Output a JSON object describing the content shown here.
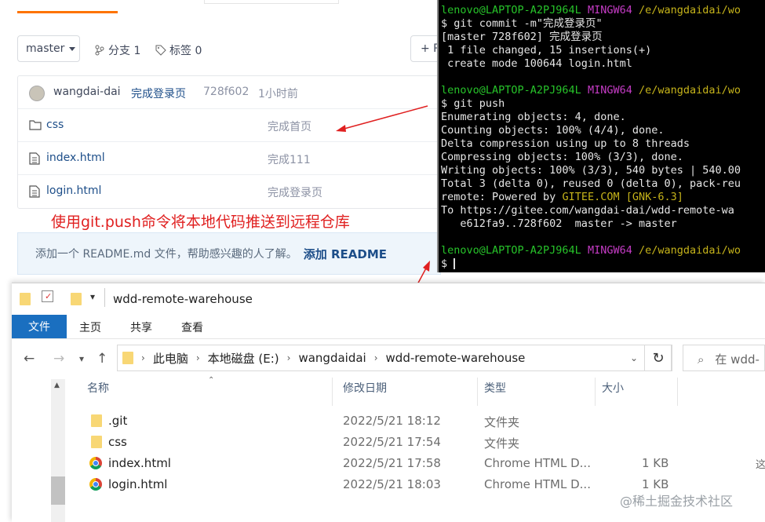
{
  "gitee": {
    "branch": "master",
    "branch_count_label": "分支 1",
    "tag_count_label": "标签 0",
    "plus_label": "+ P",
    "commit": {
      "author": "wangdai-dai",
      "message": "完成登录页",
      "hash": "728f602",
      "time": "1小时前"
    },
    "files": [
      {
        "name": "css",
        "message": "完成首页",
        "icon": "folder-icon"
      },
      {
        "name": "index.html",
        "message": "完成111",
        "icon": "file-icon"
      },
      {
        "name": "login.html",
        "message": "完成登录页",
        "icon": "file-icon"
      }
    ],
    "annotation": "使用git.push命令将本地代码推送到远程仓库",
    "readme_prompt": "添加一个 README.md 文件，帮助感兴趣的人了解。",
    "readme_link": "添加 README",
    "accent_color": "#fe7300"
  },
  "terminal": {
    "prompt_user": "lenovo@LAPTOP-A2PJ964L",
    "prompt_shell": "MINGW64",
    "prompt_path": "/e/wangdaidai/wo",
    "cmd_commit": "$ git commit -m\"完成登录页\"",
    "commit_out": [
      "[master 728f602] 完成登录页",
      " 1 file changed, 15 insertions(+)",
      " create mode 100644 login.html"
    ],
    "prompt2_path": "/e/wangdaidai/wo",
    "cmd_push": "$ git push",
    "push_out": [
      "Enumerating objects: 4, done.",
      "Counting objects: 100% (4/4), done.",
      "Delta compression using up to 8 threads",
      "Compressing objects: 100% (3/3), done.",
      "Writing objects: 100% (3/3), 540 bytes | 540.00",
      "Total 3 (delta 0), reused 0 (delta 0), pack-reu"
    ],
    "remote_prefix": "remote: Powered by ",
    "remote_site": "GITEE.COM",
    "remote_tag": "[GNK-6.3]",
    "push_to": "To https://gitee.com/wangdai-dai/wdd-remote-wa",
    "push_ref": "   e612fa9..728f602  master -> master",
    "prompt3_path": "/e/wangdaidai/wo",
    "last_prompt": "$"
  },
  "explorer": {
    "title": "wdd-remote-warehouse",
    "ribbon_tabs": [
      "文件",
      "主页",
      "共享",
      "查看"
    ],
    "breadcrumb": [
      "此电脑",
      "本地磁盘 (E:)",
      "wangdaidai",
      "wdd-remote-warehouse"
    ],
    "search_placeholder": "在 wdd-",
    "columns": {
      "name": "名称",
      "modified": "修改日期",
      "type": "类型",
      "size": "大小"
    },
    "rows": [
      {
        "name": ".git",
        "modified": "2022/5/21 18:12",
        "type": "文件夹",
        "size": "",
        "icon": "folder-icon"
      },
      {
        "name": "css",
        "modified": "2022/5/21 17:54",
        "type": "文件夹",
        "size": "",
        "icon": "folder-icon"
      },
      {
        "name": "index.html",
        "modified": "2022/5/21 17:58",
        "type": "Chrome HTML D...",
        "size": "1 KB",
        "icon": "chrome-icon"
      },
      {
        "name": "login.html",
        "modified": "2022/5/21 18:03",
        "type": "Chrome HTML D...",
        "size": "1 KB",
        "icon": "chrome-icon"
      }
    ],
    "edge_glyph": "这"
  },
  "watermark": "@稀土掘金技术社区"
}
